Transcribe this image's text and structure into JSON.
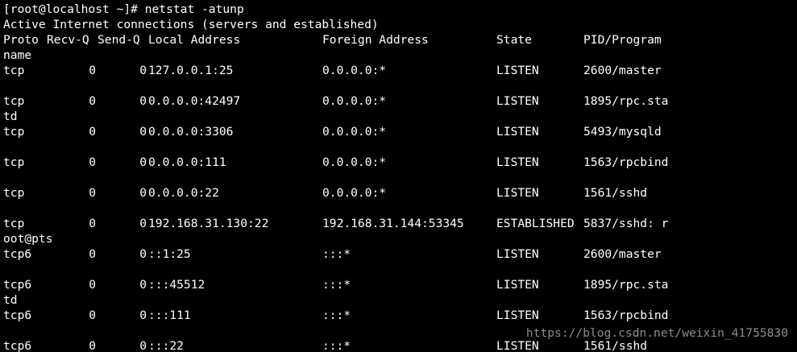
{
  "terminal": {
    "prompt": "[root@localhost ~]# ",
    "command": "netstat -atunp",
    "info_line": "Active Internet connections (servers and established)",
    "header": {
      "proto": "Proto",
      "recvq": "Recv-Q",
      "sendq": "Send-Q",
      "local": "Local Address",
      "foreign": "Foreign Address",
      "state": "State",
      "pid": "PID/Program"
    },
    "header_wrap": "name",
    "rows": [
      {
        "proto": "tcp",
        "recvq": "0",
        "sendq": "0",
        "local": "127.0.0.1:25",
        "foreign": "0.0.0.0:*",
        "state": "LISTEN",
        "pid": "2600/master",
        "wrap": ""
      },
      {
        "proto": "tcp",
        "recvq": "0",
        "sendq": "0",
        "local": "0.0.0.0:42497",
        "foreign": "0.0.0.0:*",
        "state": "LISTEN",
        "pid": "1895/rpc.sta",
        "wrap": "td"
      },
      {
        "proto": "tcp",
        "recvq": "0",
        "sendq": "0",
        "local": "0.0.0.0:3306",
        "foreign": "0.0.0.0:*",
        "state": "LISTEN",
        "pid": "5493/mysqld",
        "wrap": ""
      },
      {
        "proto": "tcp",
        "recvq": "0",
        "sendq": "0",
        "local": "0.0.0.0:111",
        "foreign": "0.0.0.0:*",
        "state": "LISTEN",
        "pid": "1563/rpcbind",
        "wrap": ""
      },
      {
        "proto": "tcp",
        "recvq": "0",
        "sendq": "0",
        "local": "0.0.0.0:22",
        "foreign": "0.0.0.0:*",
        "state": "LISTEN",
        "pid": "1561/sshd",
        "wrap": ""
      },
      {
        "proto": "tcp",
        "recvq": "0",
        "sendq": "0",
        "local": "192.168.31.130:22",
        "foreign": "192.168.31.144:53345",
        "state": "ESTABLISHED",
        "pid": "5837/sshd: r",
        "wrap": "oot@pts"
      },
      {
        "proto": "tcp6",
        "recvq": "0",
        "sendq": "0",
        "local": "::1:25",
        "foreign": ":::*",
        "state": "LISTEN",
        "pid": "2600/master",
        "wrap": ""
      },
      {
        "proto": "tcp6",
        "recvq": "0",
        "sendq": "0",
        "local": ":::45512",
        "foreign": ":::*",
        "state": "LISTEN",
        "pid": "1895/rpc.sta",
        "wrap": "td"
      },
      {
        "proto": "tcp6",
        "recvq": "0",
        "sendq": "0",
        "local": ":::111",
        "foreign": ":::*",
        "state": "LISTEN",
        "pid": "1563/rpcbind",
        "wrap": ""
      },
      {
        "proto": "tcp6",
        "recvq": "0",
        "sendq": "0",
        "local": ":::22",
        "foreign": ":::*",
        "state": "LISTEN",
        "pid": "1561/sshd",
        "wrap": ""
      }
    ]
  },
  "watermark": "https://blog.csdn.net/weixin_41755830",
  "colors": {
    "background": "#000000",
    "foreground": "#ffffff"
  }
}
